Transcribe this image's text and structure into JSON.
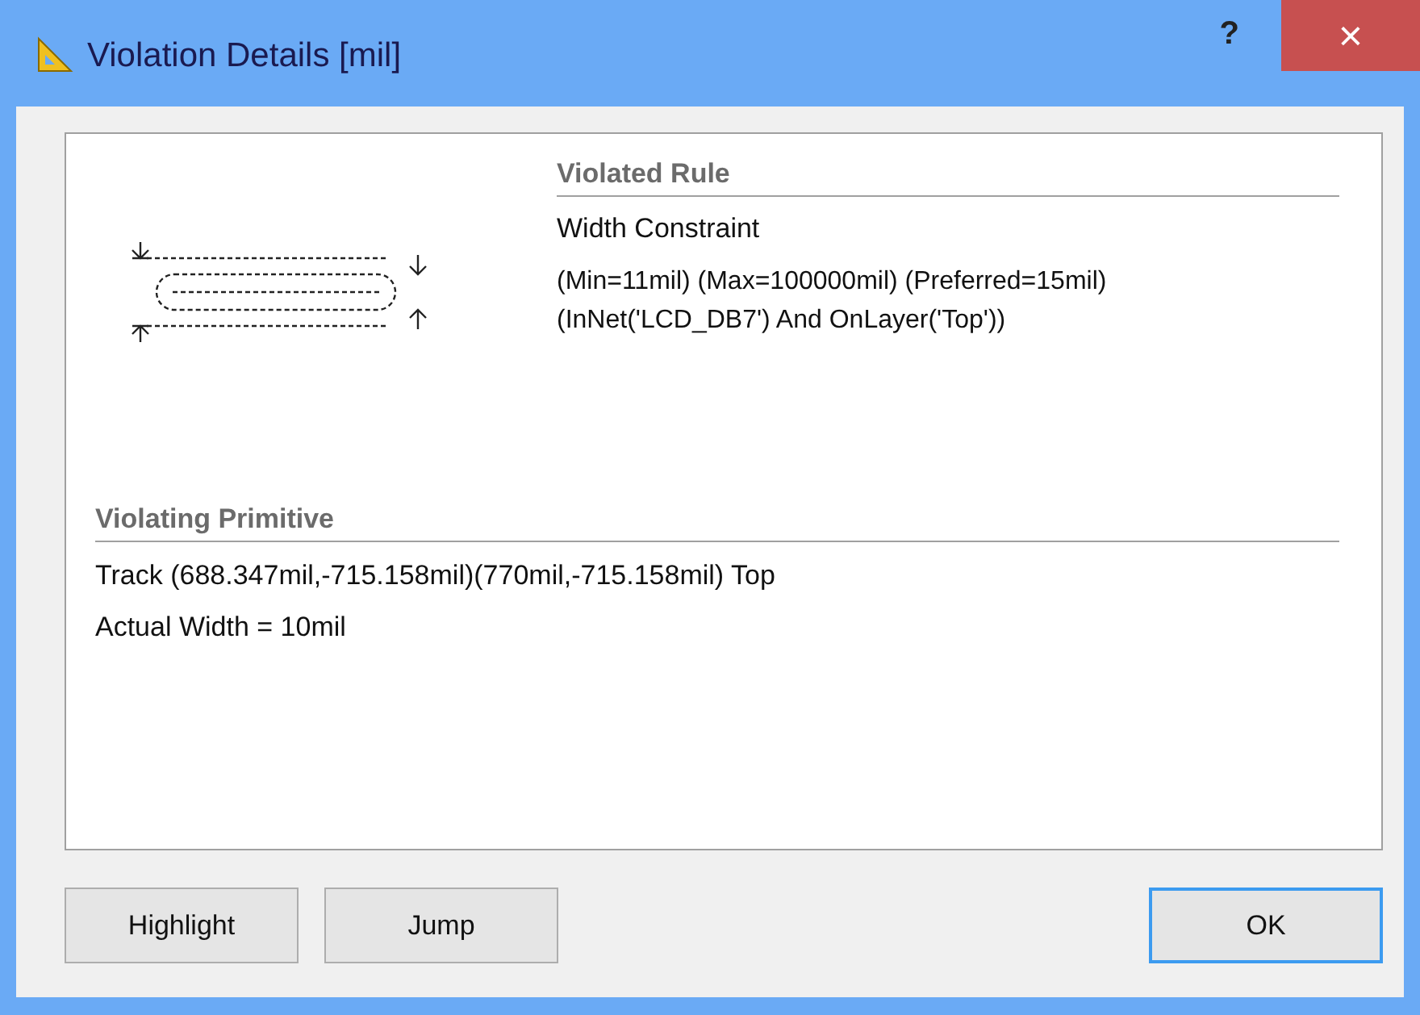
{
  "window": {
    "title": "Violation Details [mil]",
    "help": "?",
    "close": "×"
  },
  "violated_rule": {
    "heading": "Violated Rule",
    "name": "Width Constraint",
    "lines": [
      "(Min=11mil) (Max=100000mil) (Preferred=15mil)",
      "(InNet('LCD_DB7') And OnLayer('Top'))"
    ]
  },
  "violating_primitive": {
    "heading": "Violating Primitive",
    "lines": [
      "Track (688.347mil,-715.158mil)(770mil,-715.158mil)  Top",
      "Actual Width = 10mil"
    ]
  },
  "buttons": [
    {
      "label": "Highlight",
      "default": false
    },
    {
      "label": "Jump",
      "default": false
    },
    {
      "label": "OK",
      "default": true
    }
  ]
}
